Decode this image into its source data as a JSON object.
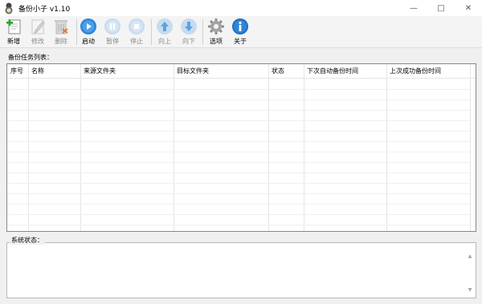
{
  "window": {
    "title": "备份小子 v1.10",
    "minimize_glyph": "—",
    "maximize_glyph": "□",
    "close_glyph": "✕"
  },
  "toolbar": {
    "add": "新增",
    "edit": "修改",
    "delete": "删除",
    "start": "启动",
    "pause": "暂停",
    "stop": "停止",
    "up": "向上",
    "down": "向下",
    "options": "选项",
    "about": "关于"
  },
  "task_list": {
    "label": "备份任务列表：",
    "columns": [
      "序号",
      "名称",
      "来源文件夹",
      "目标文件夹",
      "状态",
      "下次自动备份时间",
      "上次成功备份时间"
    ],
    "rows": []
  },
  "status": {
    "label": "系统状态：",
    "text": ""
  },
  "colors": {
    "accent_blue": "#2f86d6",
    "add_green": "#2aa52a",
    "delete_orange": "#e07b39",
    "disabled_gray": "#b5b5b5"
  }
}
